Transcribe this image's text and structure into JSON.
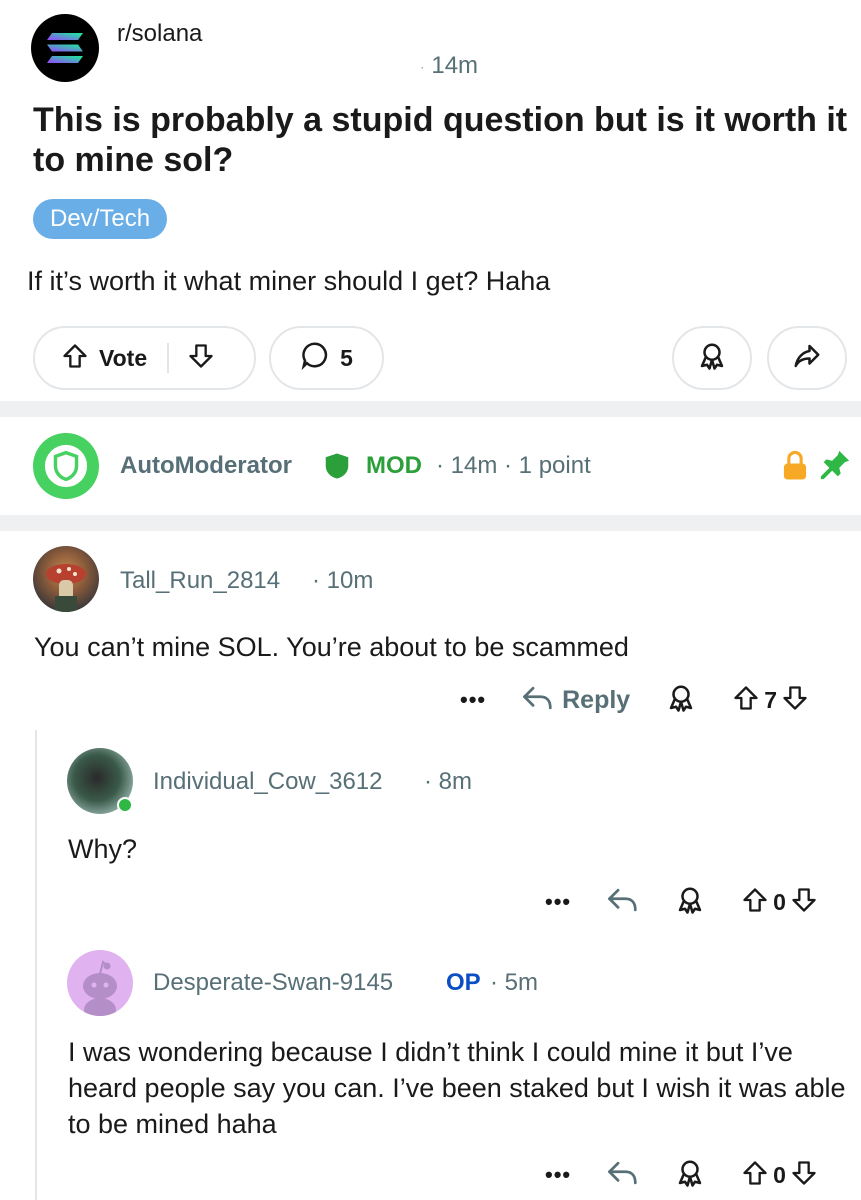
{
  "post": {
    "subreddit": "r/solana",
    "time": "14m",
    "title": "This is probably a stupid question but is it worth it to mine sol?",
    "flair": "Dev/Tech",
    "body": "If it’s worth it what miner should I get? Haha",
    "vote_label": "Vote",
    "comment_count": "5"
  },
  "automod": {
    "name": "AutoModerator",
    "badge": "MOD",
    "meta": "· 14m · 1 point"
  },
  "comments": [
    {
      "author": "Tall_Run_2814",
      "meta": "· 10m",
      "body": "You can’t mine SOL. You’re about to be scammed",
      "reply_label": "Reply",
      "score": "7"
    },
    {
      "author": "Individual_Cow_3612",
      "meta": "· 8m",
      "body": "Why?",
      "score": "0"
    },
    {
      "author": "Desperate-Swan-9145",
      "op_badge": "OP",
      "meta": "· 5m",
      "body": "I was wondering because I didn’t think I could mine it but I’ve heard people say you can. I’ve been staked but I wish it was able to be mined haha",
      "score": "0"
    }
  ],
  "icons": {
    "overflow": "•••"
  },
  "colors": {
    "flair": "#6aaee8",
    "mod_green": "#2a9f3a",
    "op_blue": "#0a4dc4",
    "meta_gray": "#576f76",
    "lock_orange": "#f7a825",
    "pin_green": "#2fb845"
  }
}
